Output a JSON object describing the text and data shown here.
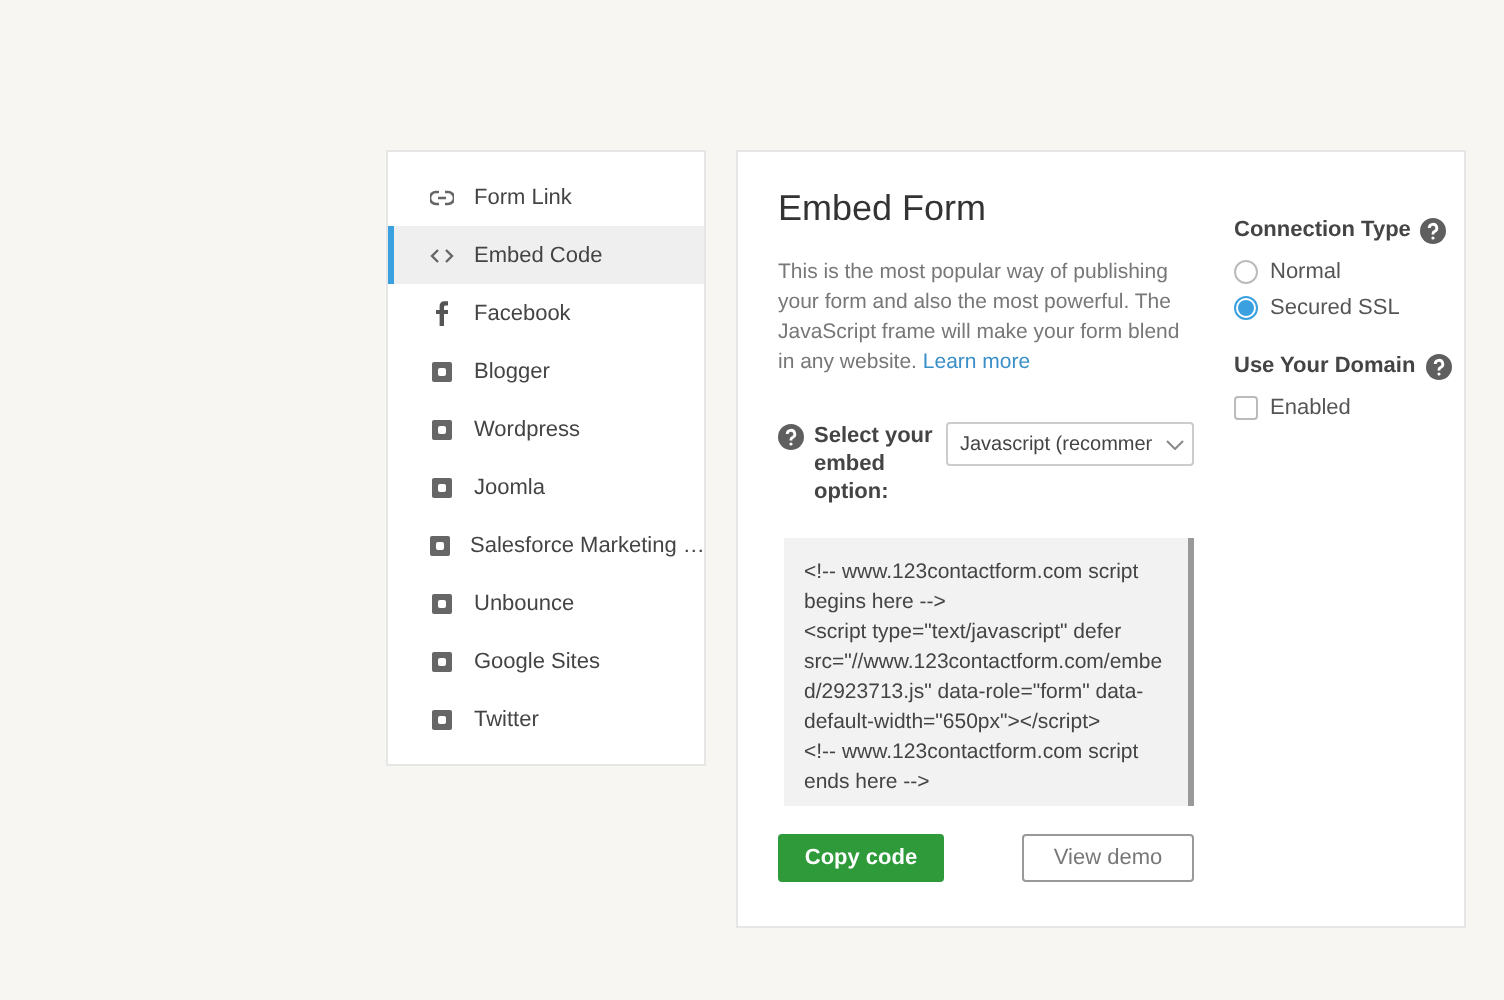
{
  "sidebar": {
    "items": [
      {
        "label": "Form Link",
        "kind": "link",
        "selected": false
      },
      {
        "label": "Embed Code",
        "kind": "code",
        "selected": true
      },
      {
        "label": "Facebook",
        "kind": "facebook",
        "selected": false
      },
      {
        "label": "Blogger",
        "kind": "badge",
        "selected": false
      },
      {
        "label": "Wordpress",
        "kind": "badge",
        "selected": false
      },
      {
        "label": "Joomla",
        "kind": "badge",
        "selected": false
      },
      {
        "label": "Salesforce Marketing …",
        "kind": "badge",
        "selected": false
      },
      {
        "label": "Unbounce",
        "kind": "badge",
        "selected": false
      },
      {
        "label": "Google Sites",
        "kind": "badge",
        "selected": false
      },
      {
        "label": "Twitter",
        "kind": "badge",
        "selected": false
      }
    ]
  },
  "main": {
    "title": "Embed Form",
    "description": "This is the most popular way of publishing your form and also the most powerful. The JavaScript frame will make your form blend in any website.",
    "learn_more": "Learn more",
    "embed_option": {
      "label": "Select your embed option:",
      "value": "Javascript (recommer"
    },
    "code": "<!-- www.123contactform.com script begins here -->\n<script type=\"text/javascript\" defer src=\"//www.123contactform.com/embed/2923713.js\" data-role=\"form\" data-default-width=\"650px\"></script>\n<!-- www.123contactform.com script ends here -->",
    "buttons": {
      "copy": "Copy code",
      "demo": "View demo"
    }
  },
  "options": {
    "connection_type": {
      "title": "Connection Type",
      "choices": [
        {
          "label": "Normal",
          "selected": false
        },
        {
          "label": "Secured SSL",
          "selected": true
        }
      ]
    },
    "domain": {
      "title": "Use Your Domain",
      "checkbox": {
        "label": "Enabled",
        "checked": false
      }
    }
  }
}
